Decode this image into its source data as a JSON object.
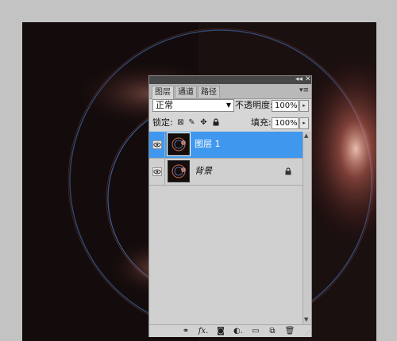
{
  "panel": {
    "tabs": [
      {
        "label": "图层"
      },
      {
        "label": "通道"
      },
      {
        "label": "路径"
      }
    ],
    "blend_mode": "正常",
    "opacity_label": "不透明度:",
    "opacity_value": "100%",
    "lock_label": "锁定:",
    "fill_label": "填充:",
    "fill_value": "100%",
    "layers": [
      {
        "name": "图层 1",
        "selected": true,
        "visible": true,
        "locked": false
      },
      {
        "name": "背景",
        "selected": false,
        "visible": true,
        "locked": true
      }
    ]
  },
  "colors": {
    "selection": "#3f97ee",
    "canvas": "#140c0c",
    "glow": "#ff8a6a",
    "ring": "#5a86c8"
  }
}
